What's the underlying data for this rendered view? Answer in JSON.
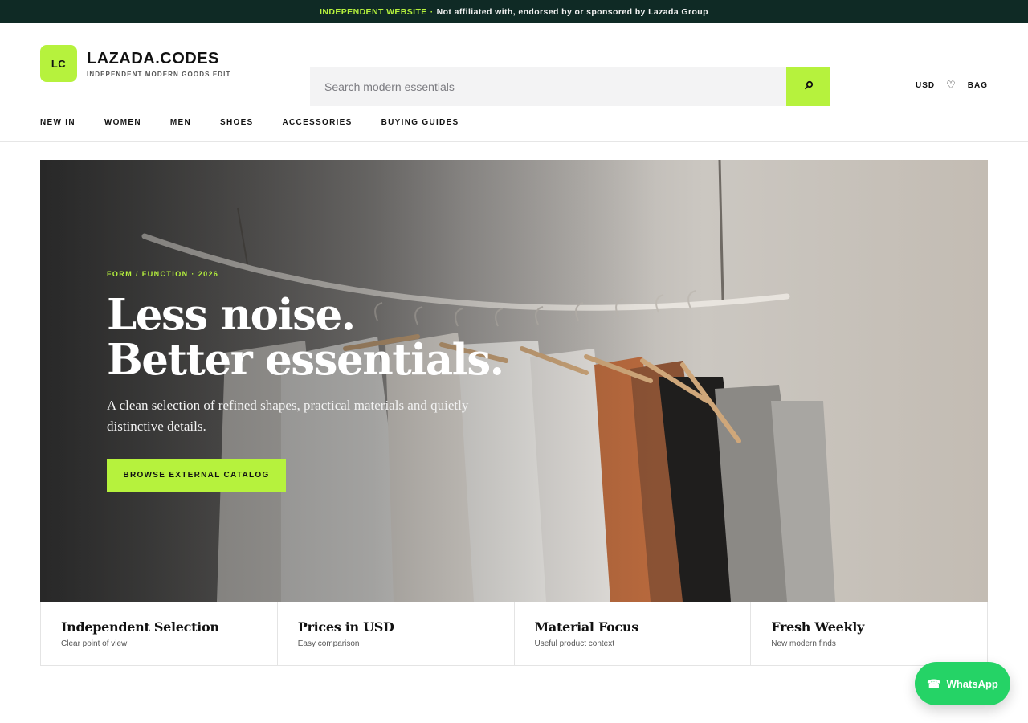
{
  "announcement": {
    "highlight": "INDEPENDENT WEBSITE",
    "separator": "·",
    "text": "Not affiliated with, endorsed by or sponsored by Lazada Group"
  },
  "brand": {
    "logo_text": "LC",
    "name": "LAZADA.CODES",
    "tagline": "INDEPENDENT MODERN GOODS EDIT"
  },
  "search": {
    "placeholder": "Search modern essentials",
    "value": "",
    "button_icon": "search-icon"
  },
  "utils": {
    "currency": "USD",
    "wishlist_icon": "heart-icon",
    "bag": "BAG"
  },
  "nav": {
    "items": [
      "NEW IN",
      "WOMEN",
      "MEN",
      "SHOES",
      "ACCESSORIES",
      "BUYING GUIDES"
    ]
  },
  "hero": {
    "eyebrow": "FORM / FUNCTION · 2026",
    "title_line1": "Less noise.",
    "title_line2": "Better essentials.",
    "subtitle": "A clean selection of refined shapes, practical materials and quietly distinctive details.",
    "cta": "BROWSE EXTERNAL CATALOG",
    "image_alt": "clothes-rack-photo"
  },
  "features": [
    {
      "title": "Independent Selection",
      "subtitle": "Clear point of view"
    },
    {
      "title": "Prices in USD",
      "subtitle": "Easy comparison"
    },
    {
      "title": "Material Focus",
      "subtitle": "Useful product context"
    },
    {
      "title": "Fresh Weekly",
      "subtitle": "New modern finds"
    }
  ],
  "whatsapp": {
    "label": "WhatsApp",
    "icon": "phone-icon"
  },
  "colors": {
    "accent": "#b6f23d",
    "topbar_bg": "#0f2a25",
    "whatsapp": "#25d366",
    "search_bg": "#f3f3f4"
  }
}
